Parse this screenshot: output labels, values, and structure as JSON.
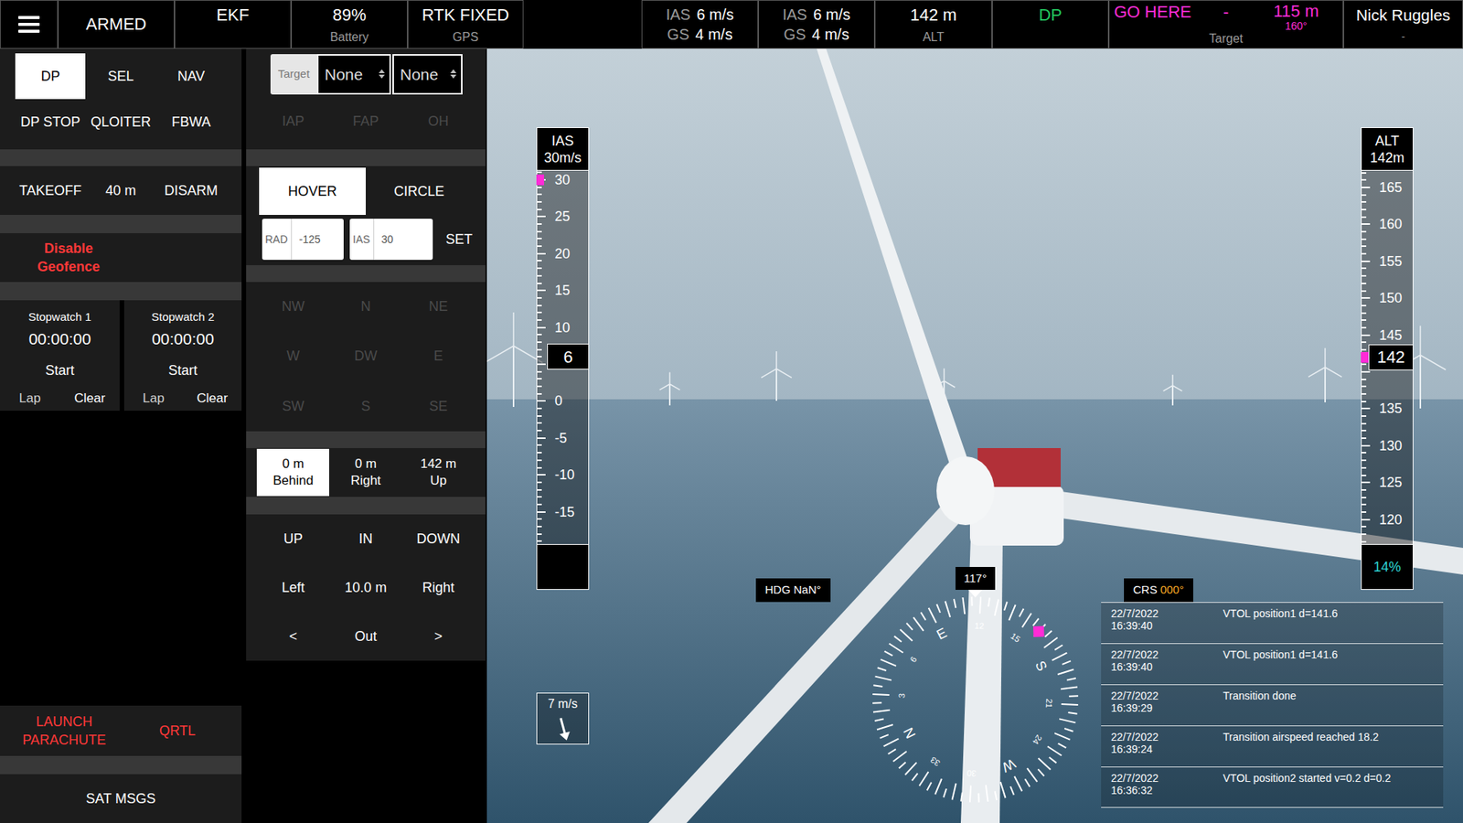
{
  "top_bar": {
    "status": "ARMED",
    "ekf": "EKF",
    "battery": {
      "value": "89%",
      "label": "Battery"
    },
    "gps": {
      "value": "RTK FIXED",
      "label": "GPS"
    },
    "speeds": [
      {
        "ias_label": "IAS",
        "ias": "6 m/s",
        "gs_label": "GS",
        "gs": "4 m/s"
      },
      {
        "ias_label": "IAS",
        "ias": "6 m/s",
        "gs_label": "GS",
        "gs": "4 m/s"
      }
    ],
    "altitude": {
      "value": "142 m",
      "label": "ALT"
    },
    "mode": "DP",
    "target": {
      "command": "GO HERE",
      "name": "-",
      "distance": "115 m",
      "bearing": "160°",
      "label": "Target"
    },
    "pilot": {
      "name": "Nick Ruggles",
      "detail": "-"
    }
  },
  "modes": [
    {
      "label": "DP",
      "selected": true
    },
    {
      "label": "SEL",
      "selected": false
    },
    {
      "label": "NAV",
      "selected": false
    },
    {
      "label": "DP STOP",
      "selected": false
    },
    {
      "label": "QLOITER",
      "selected": false
    },
    {
      "label": "FBWA",
      "selected": false
    }
  ],
  "takeoff": {
    "button": "TAKEOFF",
    "altitude": "40 m",
    "disarm": "DISARM"
  },
  "geofence": {
    "lines": [
      "Disable",
      "Geofence"
    ]
  },
  "stopwatches": [
    {
      "title": "Stopwatch 1",
      "time": "00:00:00",
      "start": "Start",
      "lap": "Lap",
      "clear": "Clear"
    },
    {
      "title": "Stopwatch 2",
      "time": "00:00:00",
      "start": "Start",
      "lap": "Lap",
      "clear": "Clear"
    }
  ],
  "emergency": [
    {
      "lines": [
        "LAUNCH",
        "PARACHUTE"
      ]
    },
    {
      "lines": [
        "QRTL"
      ]
    }
  ],
  "sat_msgs": "SAT MSGS",
  "target_select": {
    "label": "Target",
    "values": [
      "None",
      "None"
    ]
  },
  "approach": [
    {
      "label": "IAP",
      "disabled": true
    },
    {
      "label": "FAP",
      "disabled": true
    },
    {
      "label": "OH",
      "disabled": true
    }
  ],
  "loiter": [
    {
      "label": "HOVER",
      "selected": true
    },
    {
      "label": "CIRCLE",
      "selected": false
    }
  ],
  "circle": {
    "rad_label": "RAD",
    "rad": "-125",
    "ias_label": "IAS",
    "ias": "30",
    "set": "SET"
  },
  "directions": [
    {
      "label": "NW",
      "disabled": true
    },
    {
      "label": "N",
      "disabled": true
    },
    {
      "label": "NE",
      "disabled": true
    },
    {
      "label": "W",
      "disabled": true
    },
    {
      "label": "DW",
      "disabled": true
    },
    {
      "label": "E",
      "disabled": true
    },
    {
      "label": "SW",
      "disabled": true
    },
    {
      "label": "S",
      "disabled": true
    },
    {
      "label": "SE",
      "disabled": true
    }
  ],
  "offsets": [
    {
      "value": "0 m",
      "label": "Behind",
      "selected": true
    },
    {
      "value": "0 m",
      "label": "Right",
      "selected": false
    },
    {
      "value": "142 m",
      "label": "Up",
      "selected": false
    }
  ],
  "nudge": [
    [
      "UP",
      "IN",
      "DOWN"
    ],
    [
      "Left",
      "10.0 m",
      "Right"
    ],
    [
      "<",
      "Out",
      ">"
    ]
  ],
  "hud": {
    "ias_tape": {
      "title": "IAS",
      "setting": "30m/s",
      "labels": [
        "30",
        "25",
        "20",
        "15",
        "10",
        "0",
        "-5",
        "-10",
        "-15"
      ],
      "value": "6",
      "target": 30
    },
    "alt_tape": {
      "title": "ALT",
      "setting": "142m",
      "labels": [
        "165",
        "160",
        "155",
        "150",
        "145",
        "135",
        "130",
        "125",
        "120"
      ],
      "value": "142",
      "target": 142,
      "footer": "14%"
    },
    "wind": {
      "speed": "7 m/s",
      "arrow_deg": 165
    },
    "heading": "HDG NaN°",
    "compass": {
      "heading": "117°",
      "heading_deg": 117,
      "target_bearing": 160,
      "marks": [
        {
          "label": "N",
          "deg": 0
        },
        {
          "label": "3",
          "deg": 30
        },
        {
          "label": "6",
          "deg": 60
        },
        {
          "label": "E",
          "deg": 90
        },
        {
          "label": "12",
          "deg": 120
        },
        {
          "label": "15",
          "deg": 150
        },
        {
          "label": "S",
          "deg": 180
        },
        {
          "label": "21",
          "deg": 210
        },
        {
          "label": "24",
          "deg": 240
        },
        {
          "label": "W",
          "deg": 270
        },
        {
          "label": "30",
          "deg": 300
        },
        {
          "label": "33",
          "deg": 330
        }
      ]
    },
    "course": {
      "label": "CRS",
      "value": "000°"
    },
    "messages": [
      {
        "date": "22/7/2022",
        "time": "16:39:40",
        "text": "VTOL position1 d=141.6"
      },
      {
        "date": "22/7/2022",
        "time": "16:39:40",
        "text": "VTOL position1 d=141.6"
      },
      {
        "date": "22/7/2022",
        "time": "16:39:29",
        "text": "Transition done"
      },
      {
        "date": "22/7/2022",
        "time": "16:39:24",
        "text": "Transition airspeed reached 18.2"
      },
      {
        "date": "22/7/2022",
        "time": "16:36:32",
        "text": "VTOL position2 started v=0.2 d=0.2"
      }
    ]
  }
}
